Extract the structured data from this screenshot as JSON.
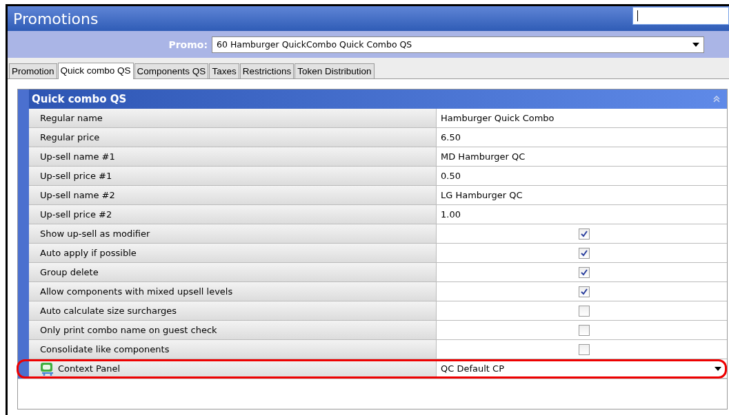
{
  "window": {
    "title": "Promotions"
  },
  "promo": {
    "label": "Promo:",
    "value": "60 Hamburger QuickCombo Quick Combo QS"
  },
  "tabs": [
    {
      "label": "Promotion",
      "selected": false
    },
    {
      "label": "Quick combo QS",
      "selected": true
    },
    {
      "label": "Components QS",
      "selected": false
    },
    {
      "label": "Taxes",
      "selected": false
    },
    {
      "label": "Restrictions",
      "selected": false
    },
    {
      "label": "Token Distribution",
      "selected": false
    }
  ],
  "panel": {
    "title": "Quick combo QS",
    "rows": [
      {
        "kind": "text",
        "label": "Regular name",
        "value": "Hamburger Quick Combo"
      },
      {
        "kind": "text",
        "label": "Regular price",
        "value": "6.50"
      },
      {
        "kind": "text",
        "label": "Up-sell name #1",
        "value": "MD Hamburger QC"
      },
      {
        "kind": "text",
        "label": "Up-sell price #1",
        "value": "0.50"
      },
      {
        "kind": "text",
        "label": "Up-sell name #2",
        "value": "LG Hamburger QC"
      },
      {
        "kind": "text",
        "label": "Up-sell price #2",
        "value": "1.00"
      },
      {
        "kind": "checkbox",
        "label": "Show up-sell as modifier",
        "checked": true
      },
      {
        "kind": "checkbox",
        "label": "Auto apply if possible",
        "checked": true
      },
      {
        "kind": "checkbox",
        "label": "Group delete",
        "checked": true
      },
      {
        "kind": "checkbox",
        "label": "Allow components with mixed upsell levels",
        "checked": true
      },
      {
        "kind": "checkbox",
        "label": "Auto calculate size surcharges",
        "checked": false
      },
      {
        "kind": "checkbox",
        "label": "Only print combo name on guest check",
        "checked": false
      },
      {
        "kind": "checkbox",
        "label": "Consolidate like components",
        "checked": false
      },
      {
        "kind": "dropdown",
        "label": "Context Panel",
        "value": "QC Default CP",
        "highlighted": true
      }
    ]
  }
}
